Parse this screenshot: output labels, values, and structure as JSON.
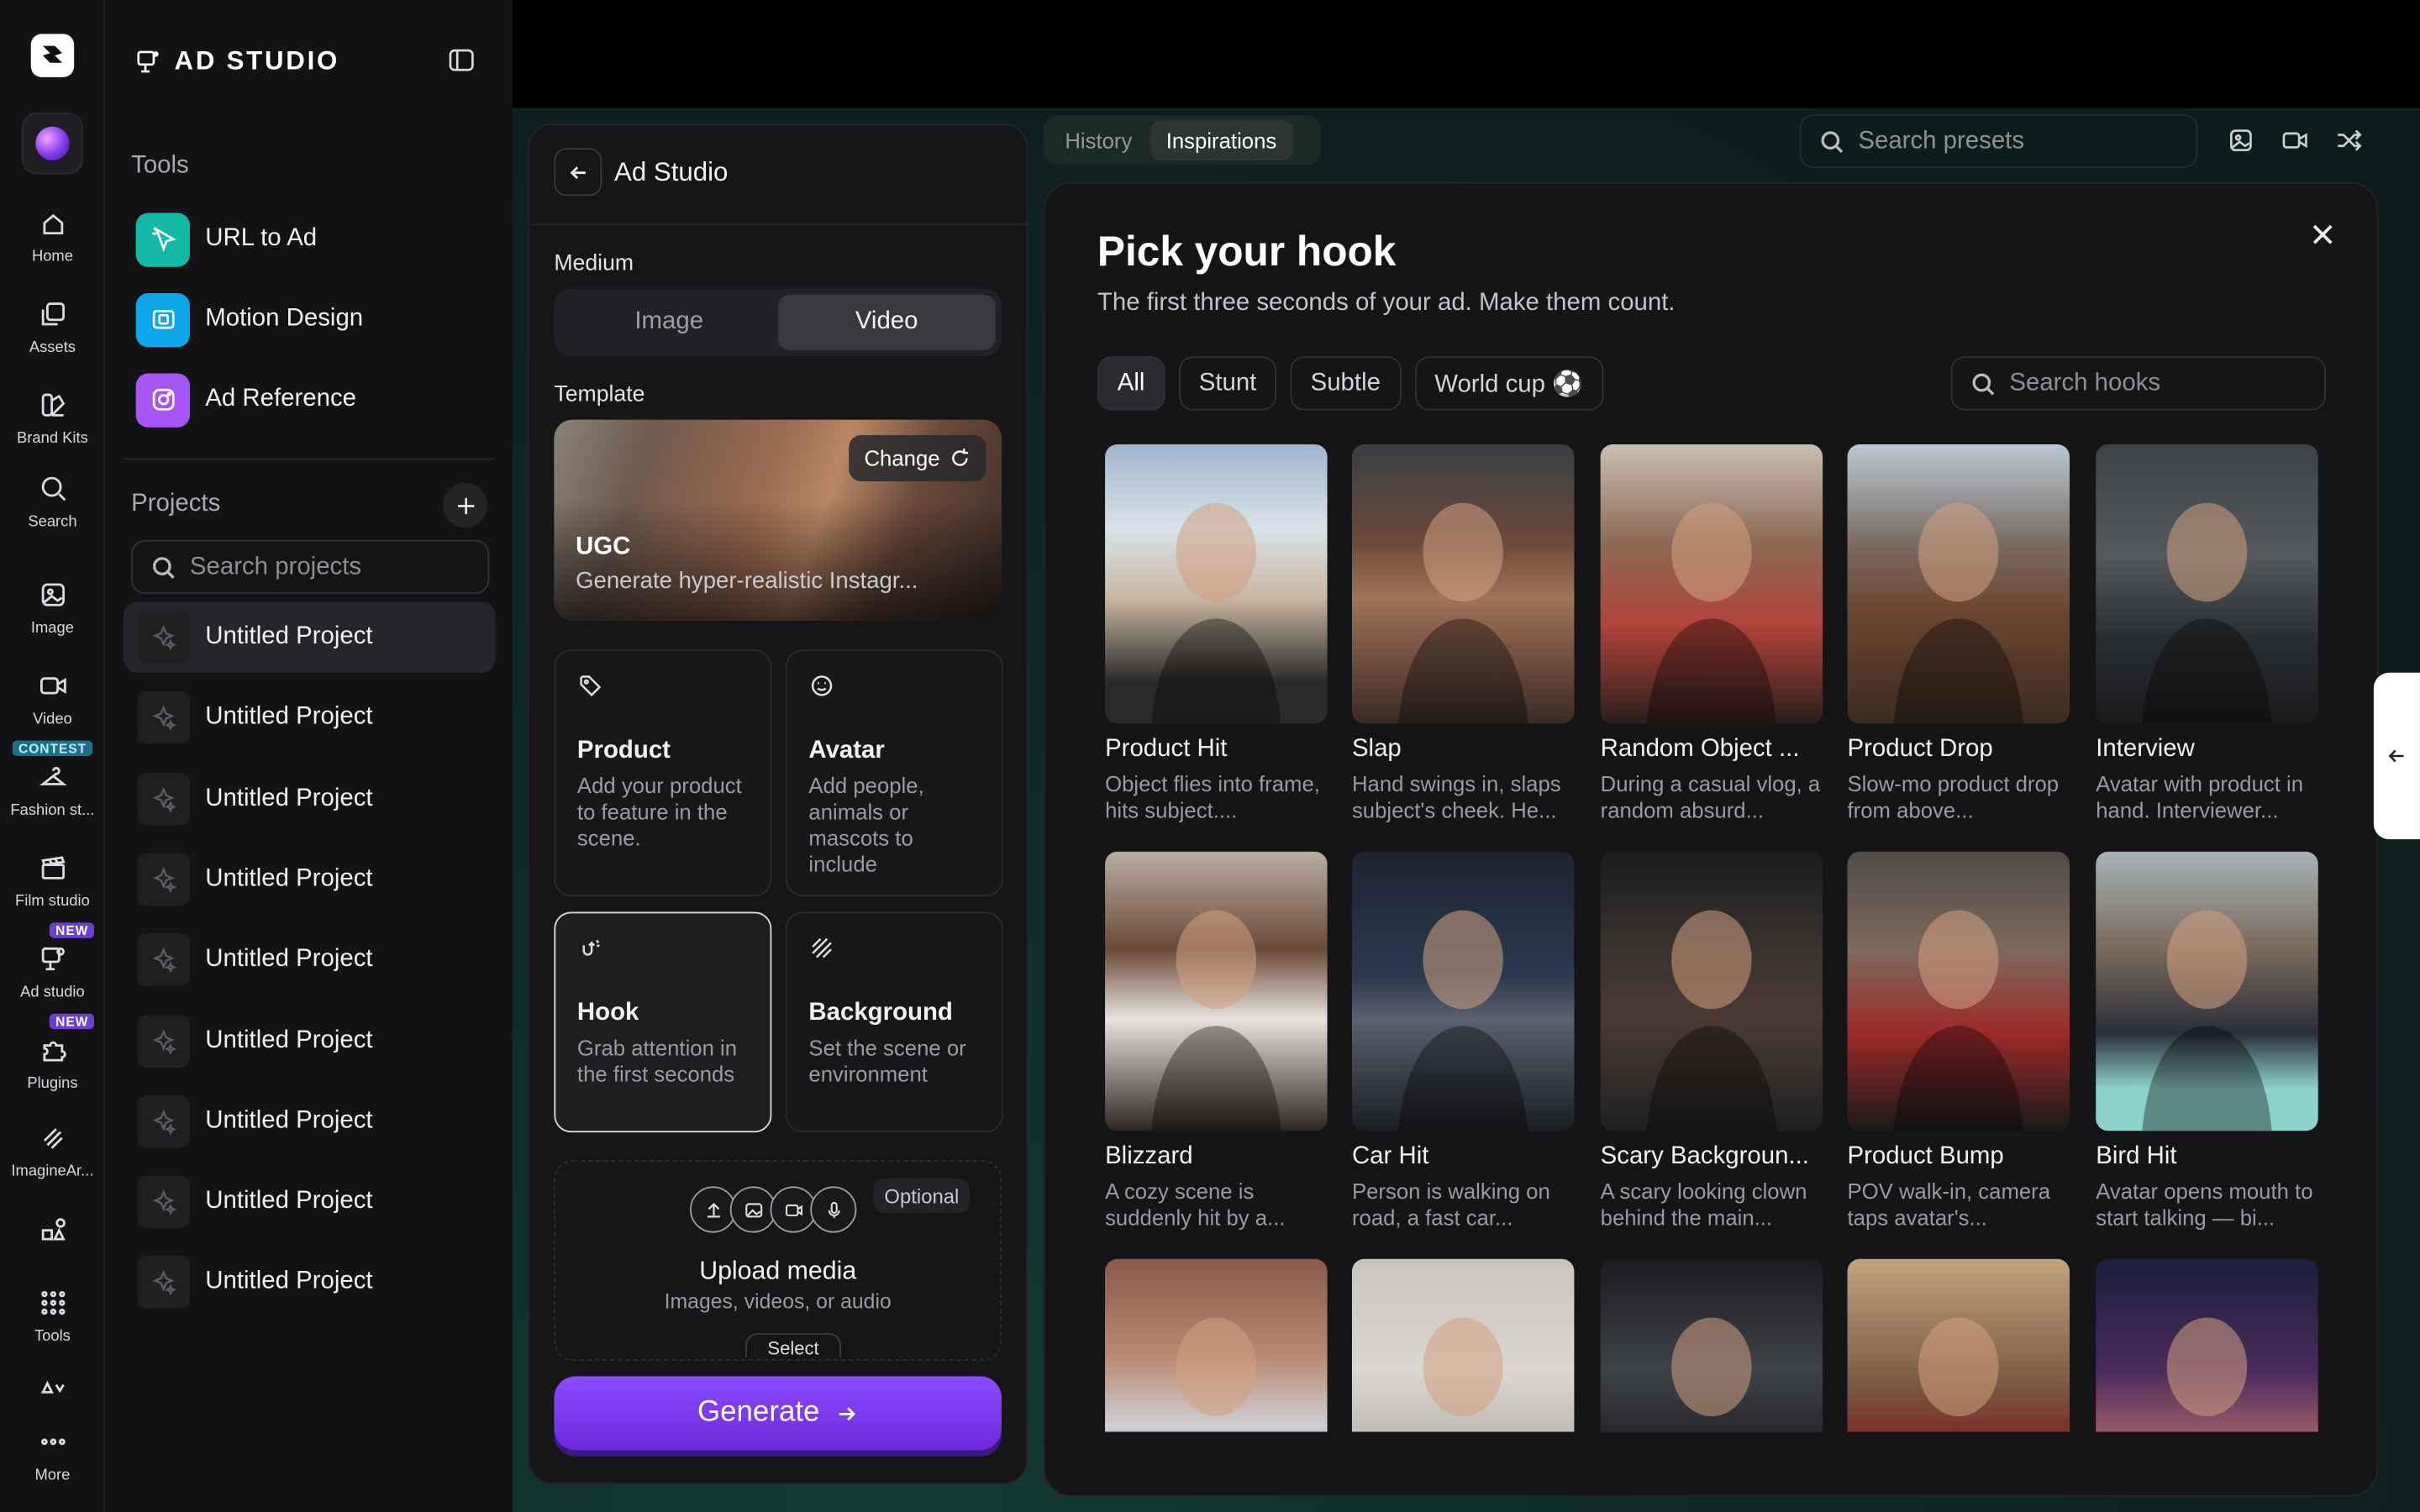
{
  "rail": {
    "items": [
      {
        "label": "Home",
        "icon": "home-icon"
      },
      {
        "label": "Assets",
        "icon": "assets-icon"
      },
      {
        "label": "Brand Kits",
        "icon": "brand-kits-icon"
      },
      {
        "label": "Search",
        "icon": "search-icon"
      },
      {
        "label": "Image",
        "icon": "image-icon"
      },
      {
        "label": "Video",
        "icon": "video-icon"
      },
      {
        "label": "Fashion st...",
        "icon": "hanger-icon"
      },
      {
        "label": "Film studio",
        "icon": "clapperboard-icon"
      },
      {
        "label": "Ad studio",
        "icon": "ad-studio-icon"
      },
      {
        "label": "Plugins",
        "icon": "puzzle-icon"
      },
      {
        "label": "ImagineAr...",
        "icon": "imagineart-icon"
      },
      {
        "label": "",
        "icon": "shapes-icon"
      },
      {
        "label": "Tools",
        "icon": "grid-icon"
      },
      {
        "label": "",
        "icon": "shapes-small-icon"
      },
      {
        "label": "More",
        "icon": "more-icon"
      }
    ],
    "badges": {
      "contest": "CONTEST",
      "new": "NEW"
    },
    "colors": {
      "contest": "#1e6f8a",
      "new": "#6b3fd1"
    }
  },
  "sidebar": {
    "brand": "AD STUDIO",
    "tools_title": "Tools",
    "tools": [
      {
        "label": "URL to Ad",
        "color": "#14b8a6"
      },
      {
        "label": "Motion Design",
        "color": "#0ea5e9"
      },
      {
        "label": "Ad Reference",
        "color": "#a855f7"
      }
    ],
    "projects_title": "Projects",
    "search_placeholder": "Search projects",
    "projects": [
      "Untitled Project",
      "Untitled Project",
      "Untitled Project",
      "Untitled Project",
      "Untitled Project",
      "Untitled Project",
      "Untitled Project",
      "Untitled Project",
      "Untitled Project"
    ]
  },
  "panel": {
    "title": "Ad Studio",
    "medium_label": "Medium",
    "medium_options": [
      "Image",
      "Video"
    ],
    "medium_selected": "Video",
    "template_label": "Template",
    "template": {
      "name": "UGC",
      "desc": "Generate hyper-realistic Instagr...",
      "change": "Change"
    },
    "cards": [
      {
        "title": "Product",
        "desc": "Add your product to feature in the scene.",
        "icon": "tag-icon"
      },
      {
        "title": "Avatar",
        "desc": "Add people, animals or mascots to include",
        "icon": "smiley-icon"
      },
      {
        "title": "Hook",
        "desc": "Grab attention in the first seconds",
        "icon": "hook-icon"
      },
      {
        "title": "Background",
        "desc": "Set the scene or environment",
        "icon": "hatch-icon"
      }
    ],
    "upload": {
      "optional": "Optional",
      "title": "Upload media",
      "sub": "Images, videos, or audio",
      "select": "Select"
    },
    "generate": "Generate"
  },
  "topbar": {
    "tabs": [
      "History",
      "Inspirations"
    ],
    "active_tab": "Inspirations",
    "search_placeholder": "Search presets"
  },
  "modal": {
    "title": "Pick your hook",
    "subtitle": "The first three seconds of your ad. Make them count.",
    "filters": [
      "All",
      "Stunt",
      "Subtle",
      "World cup ⚽"
    ],
    "active_filter": "All",
    "search_placeholder": "Search hooks",
    "hooks": [
      {
        "title": "Product Hit",
        "desc": "Object flies into frame, hits subject....",
        "bg": "linear-gradient(180deg,#9fb6cc 0%,#d9e2ea 30%,#c9b7a0 55%,#2a2a2c 85%)"
      },
      {
        "title": "Slap",
        "desc": "Hand swings in, slaps subject's cheek. He...",
        "bg": "linear-gradient(180deg,#3a3f45 0%,#6b4a3a 35%,#a17359 55%,#3a2a24 100%)"
      },
      {
        "title": "Random Object ...",
        "desc": "During a casual vlog, a random absurd...",
        "bg": "linear-gradient(180deg,#c9bfb3 0%,#8d6a55 35%,#b0433a 65%,#2a1f1c 100%)"
      },
      {
        "title": "Product Drop",
        "desc": "Slow-mo product drop from above...",
        "bg": "linear-gradient(180deg,#b9c7d4 0%,#7a6d63 35%,#6b4630 60%,#3c2a20 100%)"
      },
      {
        "title": "Interview",
        "desc": "Avatar with product in hand. Interviewer...",
        "bg": "linear-gradient(180deg,#3c4246 0%,#53595c 40%,#2a2d30 70%,#1a1b1d 100%)"
      },
      {
        "title": "Blizzard",
        "desc": "A cozy scene is suddenly hit by a...",
        "bg": "linear-gradient(180deg,#b7aea2 0%,#6b4a37 35%,#e6e2dc 60%,#2e2622 100%)"
      },
      {
        "title": "Car Hit",
        "desc": "Person is walking on road, a fast car...",
        "bg": "linear-gradient(180deg,#1c2431 0%,#2c3a4f 45%,#5a6170 60%,#1b1d22 100%)"
      },
      {
        "title": "Scary Backgroun...",
        "desc": "A scary looking clown behind the main...",
        "bg": "linear-gradient(180deg,#1a1c1e 0%,#3a3330 35%,#4b3a33 60%,#1f2022 100%)"
      },
      {
        "title": "Product Bump",
        "desc": "POV walk-in, camera taps avatar's...",
        "bg": "linear-gradient(180deg,#4f4a46 0%,#7e6a5c 35%,#9b2a2a 65%,#1a1a1b 100%)"
      },
      {
        "title": "Bird Hit",
        "desc": "Avatar opens mouth to start talking — bi...",
        "bg": "linear-gradient(180deg,#a7b2b7 0%,#7a6a5a 35%,#2a2f3b 65%,#8fd1cc 85%)"
      },
      {
        "title": "",
        "desc": "",
        "bg": "linear-gradient(180deg,#8a5a4b 0%,#b88a72 35%,#cfcfd3 60%,#2d4f86 100%)"
      },
      {
        "title": "",
        "desc": "",
        "bg": "linear-gradient(180deg,#c9c4bd 0%,#dad6d0 40%,#b7b2ac 70%,#9f9a94 100%)"
      },
      {
        "title": "",
        "desc": "",
        "bg": "linear-gradient(180deg,#1b1c1f 0%,#3f4248 40%,#1e1f22 70%,#2a2b2e 100%)"
      },
      {
        "title": "",
        "desc": "",
        "bg": "linear-gradient(180deg,#c2a27e 0%,#7a5a44 45%,#7a1d1d 70%,#1a1a1a 100%)"
      },
      {
        "title": "",
        "desc": "",
        "bg": "linear-gradient(180deg,#1b1f3d 0%,#4a2b5c 40%,#b36a6a 70%,#2a1a2f 100%)"
      }
    ]
  }
}
